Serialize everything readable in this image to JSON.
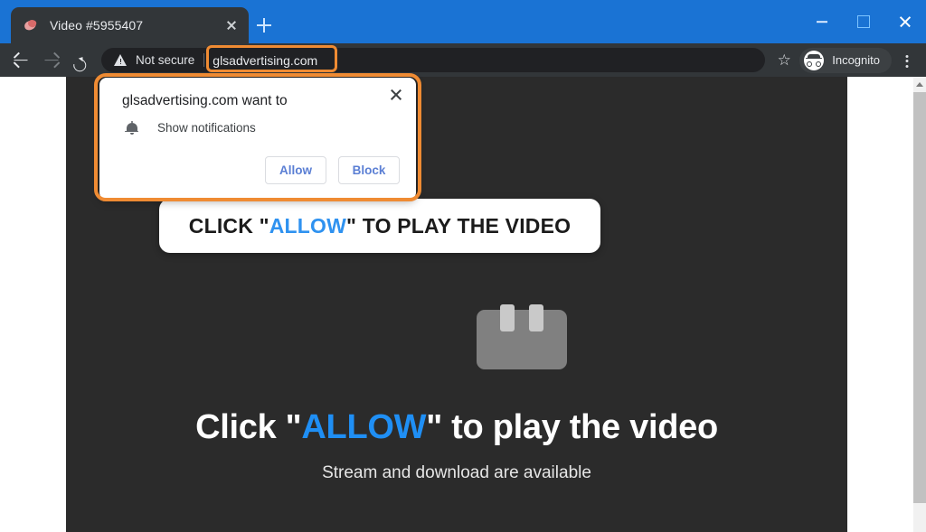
{
  "window": {
    "controls": {
      "minimize_label": "Minimize",
      "maximize_label": "Maximize",
      "close_label": "Close"
    }
  },
  "tabs": [
    {
      "title": "Video #5955407",
      "favicon": "video-site-favicon",
      "close_label": "Close tab"
    }
  ],
  "new_tab_label": "New tab",
  "toolbar": {
    "back_label": "Back",
    "forward_label": "Forward",
    "reload_label": "Reload",
    "security_text": "Not secure",
    "url": "glsadvertising.com",
    "bookmark_icon": "star-icon",
    "bookmark_glyph": "☆",
    "profile_label": "Incognito",
    "menu_label": "Customize and control Google Chrome"
  },
  "permission_popup": {
    "title": "glsadvertising.com want to",
    "request_icon": "bell-icon",
    "request_label": "Show notifications",
    "allow_label": "Allow",
    "block_label": "Block",
    "close_label": "Close"
  },
  "banner": {
    "prefix": "CLICK \"",
    "highlight": "ALLOW",
    "suffix": "\" TO PLAY THE VIDEO"
  },
  "page": {
    "headline_prefix": "Click \"",
    "headline_highlight": "ALLOW",
    "headline_suffix": "\" to play the video",
    "subtitle": "Stream and download are available",
    "video_placeholder": "video-placeholder-icon"
  },
  "scrollbar": {
    "up_label": "Scroll up"
  },
  "colors": {
    "titlebar": "#1a73d4",
    "chrome_dark": "#323639",
    "omnibox": "#202124",
    "page_bg": "#2b2b2b",
    "accent_orange": "#ef8b33",
    "link_blue": "#1f8ff5",
    "button_blue": "#5b7fd4"
  }
}
